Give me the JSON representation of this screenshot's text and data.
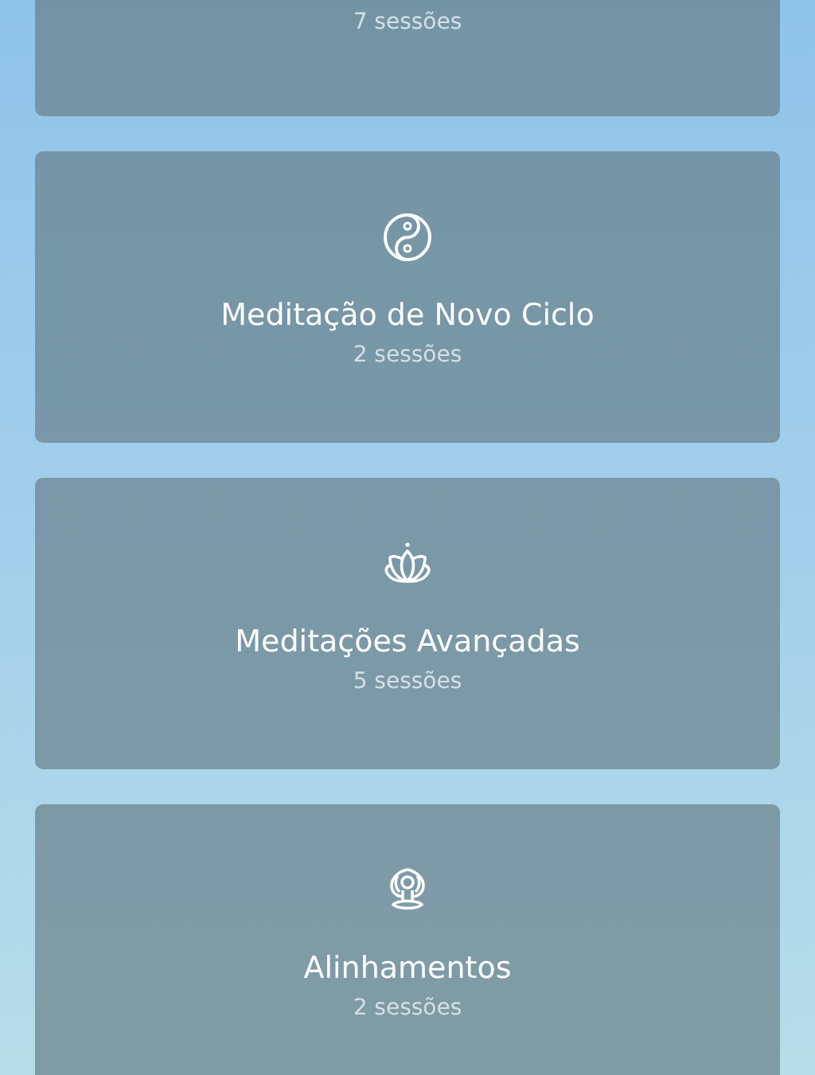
{
  "cards": [
    {
      "count": "7 sessões"
    },
    {
      "kind": "yin-yang",
      "title": "Meditação de Novo Ciclo",
      "count": "2 sessões"
    },
    {
      "kind": "lotus",
      "title": "Meditações Avançadas",
      "count": "5 sessões"
    },
    {
      "kind": "meditator",
      "title": "Alinhamentos",
      "count": "2 sessões"
    }
  ]
}
